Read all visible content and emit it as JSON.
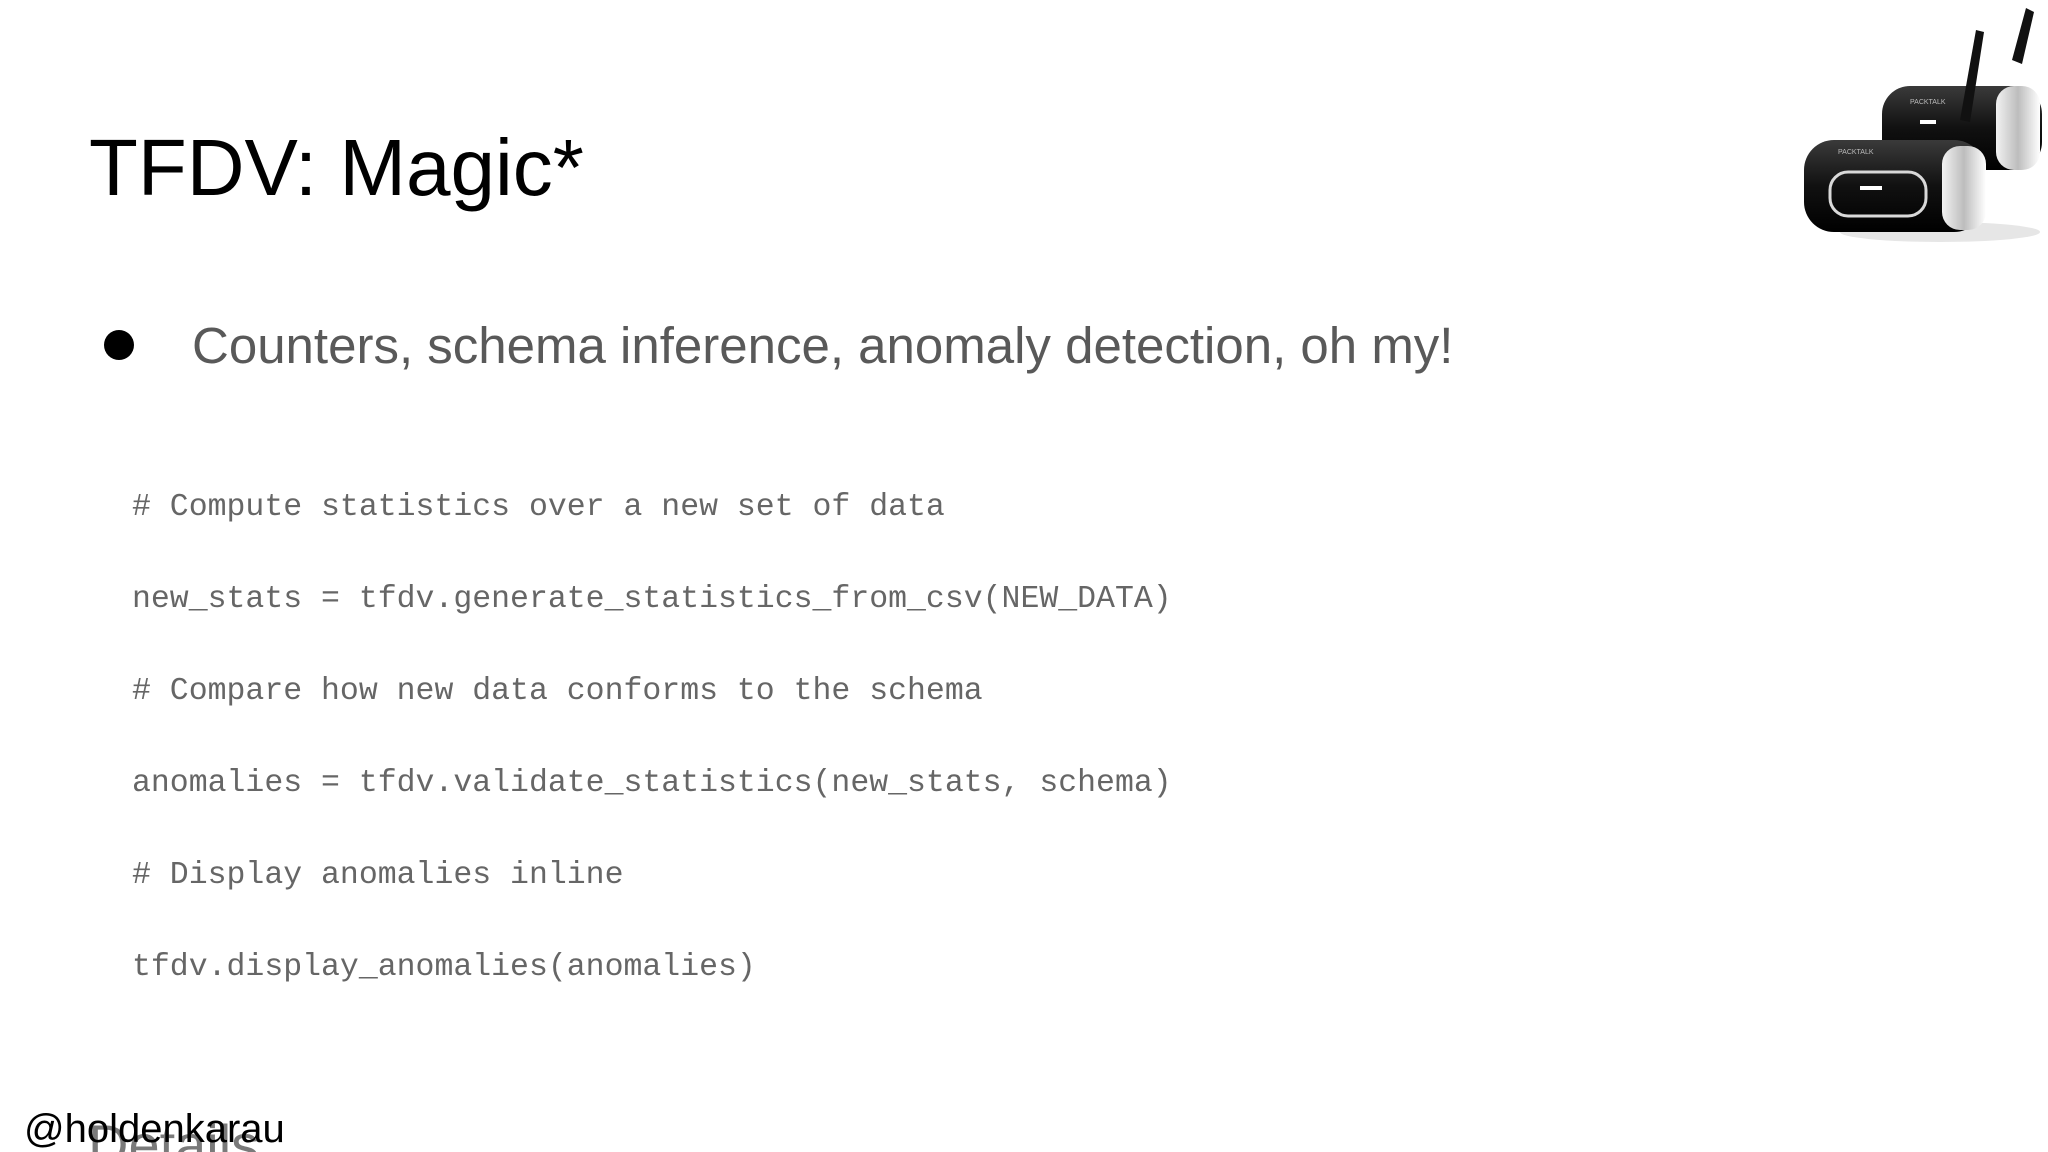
{
  "slide": {
    "title": "TFDV: Magic*",
    "bullets": [
      "Counters, schema inference, anomaly detection, oh my!"
    ],
    "code_lines": [
      "# Compute statistics over a new set of data",
      "new_stats = tfdv.generate_statistics_from_csv(NEW_DATA)",
      "# Compare how new data conforms to the schema",
      "anomalies = tfdv.validate_statistics(new_stats, schema)",
      "# Display anomalies inline",
      "tfdv.display_anomalies(anomalies)"
    ],
    "footer_ghost": "Details",
    "handle": "@holdenkarau",
    "image": {
      "icon": "headset-intercom-image",
      "brand_text": "PACKTALK"
    }
  }
}
